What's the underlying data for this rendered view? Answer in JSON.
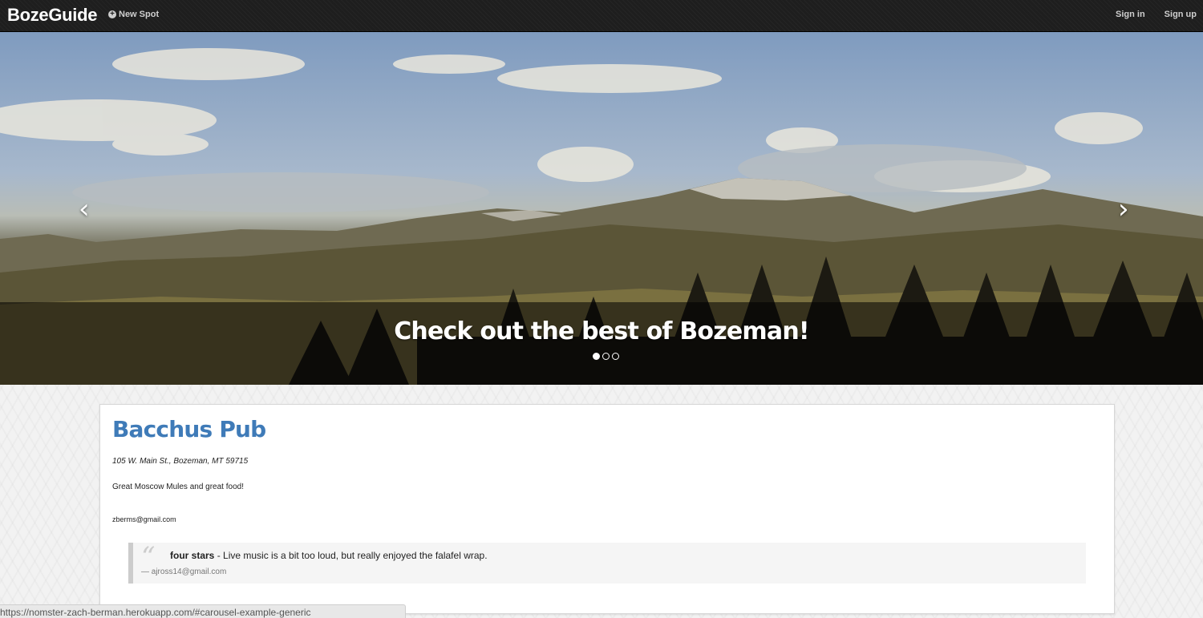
{
  "navbar": {
    "brand": "BozeGuide",
    "new_spot": "New Spot",
    "sign_in": "Sign in",
    "sign_up": "Sign up"
  },
  "carousel": {
    "caption": "Check out the best of Bozeman!",
    "prev_glyph": "‹",
    "next_glyph": "›",
    "slide_count": 3,
    "active_slide": 1
  },
  "spot": {
    "title": "Bacchus Pub",
    "address": "105 W. Main St., Bozeman, MT 59715",
    "description": "Great Moscow Mules and great food!",
    "email": "zberms@gmail.com",
    "review": {
      "rating": "four stars",
      "text": " - Live music is a bit too loud, but really enjoyed the falafel wrap.",
      "author": "— ajross14@gmail.com"
    }
  },
  "status_bar": {
    "url": "https://nomster-zach-berman.herokuapp.com/#carousel-example-generic"
  },
  "colors": {
    "navbar_bg": "#1e1e1e",
    "title_link": "#3f7bb8",
    "page_bg": "#f2f2f2"
  }
}
